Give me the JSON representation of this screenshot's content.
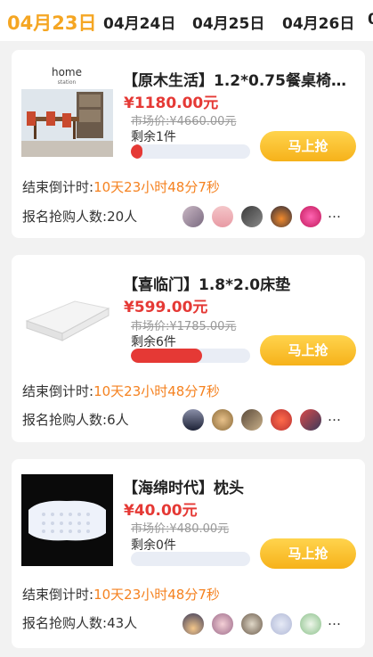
{
  "tabs": [
    "04月23日",
    "04月24日",
    "04月25日",
    "04月26日",
    "0"
  ],
  "countdown_label": "结束倒计时:",
  "countdown_value": "10天23小时48分7秒",
  "signup_label_prefix": "报名抢购人数:",
  "button_label": "马上抢",
  "products": [
    {
      "title": "【原木生活】1.2*0.75餐桌椅…",
      "price": "¥1180.00元",
      "market_price": "市场价:¥4660.00元",
      "remain": "剩余1件",
      "progress": 0.1,
      "signups": "20人",
      "logo_text": "home",
      "logo_sub": "station"
    },
    {
      "title": "【喜临门】1.8*2.0床垫",
      "price": "¥599.00元",
      "market_price": "市场价:¥1785.00元",
      "remain": "剩余6件",
      "progress": 0.6,
      "signups": "6人"
    },
    {
      "title": "【海绵时代】枕头",
      "price": "¥40.00元",
      "market_price": "市场价:¥480.00元",
      "remain": "剩余0件",
      "progress": 0.0,
      "signups": "43人"
    }
  ],
  "more_glyph": "…",
  "colors": {
    "accent": "#f5a623",
    "price": "#e53935",
    "countdown": "#f58220",
    "button": "#f6b21a"
  }
}
